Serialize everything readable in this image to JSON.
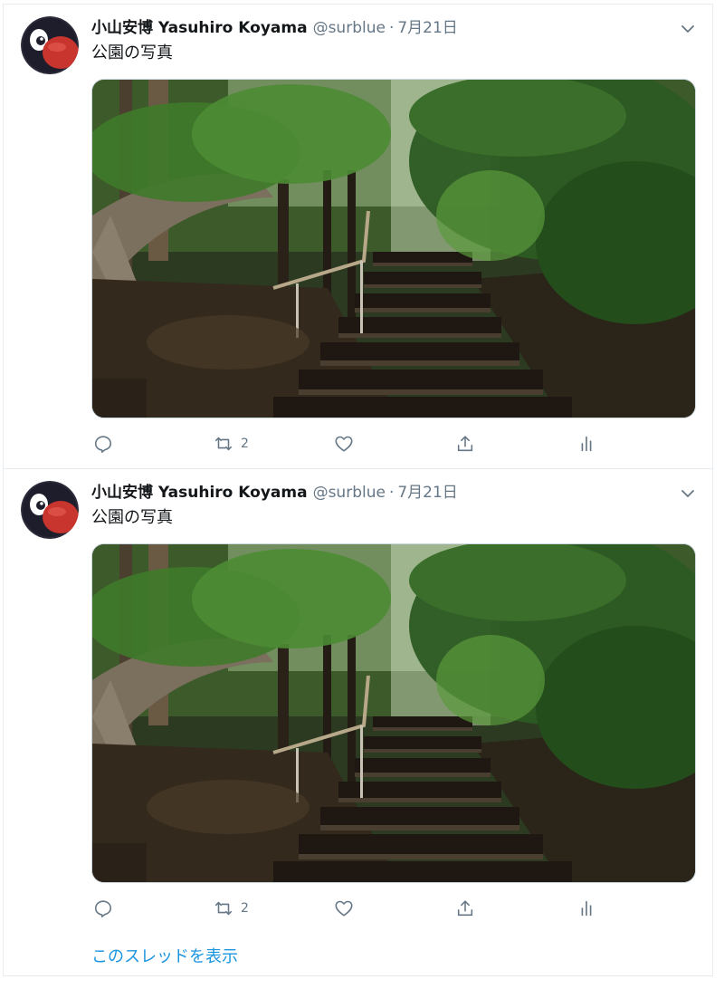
{
  "tweets": [
    {
      "display_name": "小山安博 Yasuhiro Koyama",
      "handle": "@surblue",
      "separator": "·",
      "date": "7月21日",
      "text": "公園の写真",
      "photo_icon": "park-stairs-photo",
      "actions": {
        "reply_icon": "reply-icon",
        "retweet_icon": "retweet-icon",
        "retweet_count": "2",
        "like_icon": "heart-icon",
        "share_icon": "share-icon",
        "stats_icon": "analytics-icon"
      }
    },
    {
      "display_name": "小山安博 Yasuhiro Koyama",
      "handle": "@surblue",
      "separator": "·",
      "date": "7月21日",
      "text": "公園の写真",
      "photo_icon": "park-stairs-photo",
      "actions": {
        "reply_icon": "reply-icon",
        "retweet_icon": "retweet-icon",
        "retweet_count": "2",
        "like_icon": "heart-icon",
        "share_icon": "share-icon",
        "stats_icon": "analytics-icon"
      }
    }
  ],
  "thread_link": "このスレッドを表示",
  "colors": {
    "text": "#14171a",
    "secondary": "#657786",
    "link": "#1b95e0",
    "border": "#e6ecf0"
  }
}
